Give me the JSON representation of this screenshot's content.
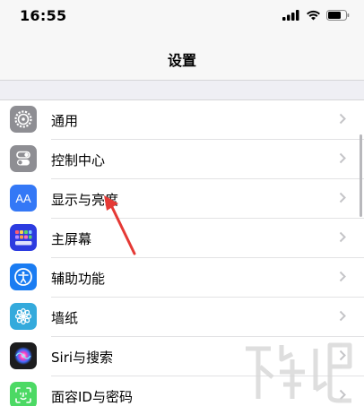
{
  "status": {
    "time": "16:55"
  },
  "nav": {
    "title": "设置"
  },
  "settings": {
    "items": [
      {
        "label": "通用",
        "icon": "gear-icon",
        "color": "#8e8e93"
      },
      {
        "label": "控制中心",
        "icon": "toggles-icon",
        "color": "#8e8e93"
      },
      {
        "label": "显示与亮度",
        "icon": "text-size-icon",
        "icon_text": "AA",
        "color": "#3478f6"
      },
      {
        "label": "主屏幕",
        "icon": "home-grid-icon",
        "color": "#2c3be0"
      },
      {
        "label": "辅助功能",
        "icon": "accessibility-icon",
        "color": "#1a7cf2"
      },
      {
        "label": "墙纸",
        "icon": "wallpaper-flower-icon",
        "color": "#34aadc"
      },
      {
        "label": "Siri与搜索",
        "icon": "siri-icon",
        "color": "#222222"
      },
      {
        "label": "面容ID与密码",
        "icon": "face-id-icon",
        "color": "#4cd964"
      }
    ]
  },
  "colors": {
    "annotation_arrow": "#e53935",
    "separator": "#e2e2e4",
    "background": "#efeff4"
  }
}
